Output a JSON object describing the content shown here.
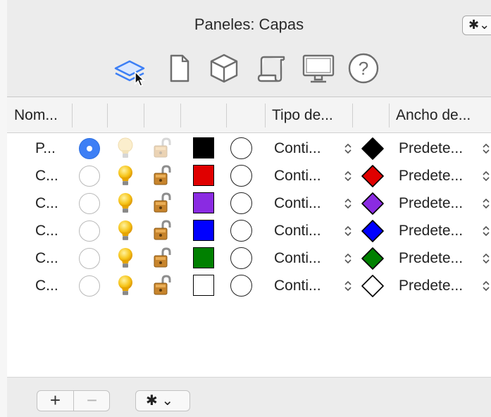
{
  "window": {
    "title": "Paneles: Capas",
    "gear_menu": "✱⌄"
  },
  "toolbar": {
    "icons": [
      "layers-icon",
      "document-icon",
      "cube-icon",
      "scroll-icon",
      "display-icon",
      "help-icon"
    ],
    "active": "layers-icon"
  },
  "columns": [
    "Nom...",
    "Tipo de...",
    "Ancho de..."
  ],
  "rows": [
    {
      "name": "P...",
      "current": true,
      "light_on": false,
      "color": "#000000",
      "linetype": "Conti...",
      "print_color": "#000000",
      "width": "Predete..."
    },
    {
      "name": "C...",
      "current": false,
      "light_on": true,
      "color": "#e00000",
      "linetype": "Conti...",
      "print_color": "#e00000",
      "width": "Predete..."
    },
    {
      "name": "C...",
      "current": false,
      "light_on": true,
      "color": "#8a2be2",
      "linetype": "Conti...",
      "print_color": "#8a2be2",
      "width": "Predete..."
    },
    {
      "name": "C...",
      "current": false,
      "light_on": true,
      "color": "#0000ff",
      "linetype": "Conti...",
      "print_color": "#0000ff",
      "width": "Predete..."
    },
    {
      "name": "C...",
      "current": false,
      "light_on": true,
      "color": "#008000",
      "linetype": "Conti...",
      "print_color": "#008000",
      "width": "Predete..."
    },
    {
      "name": "C...",
      "current": false,
      "light_on": true,
      "color": "#ffffff",
      "linetype": "Conti...",
      "print_color": "#ffffff",
      "width": "Predete..."
    }
  ],
  "footer": {
    "add_label": "+",
    "remove_label": "−",
    "gear_menu": "✱ ⌄"
  }
}
